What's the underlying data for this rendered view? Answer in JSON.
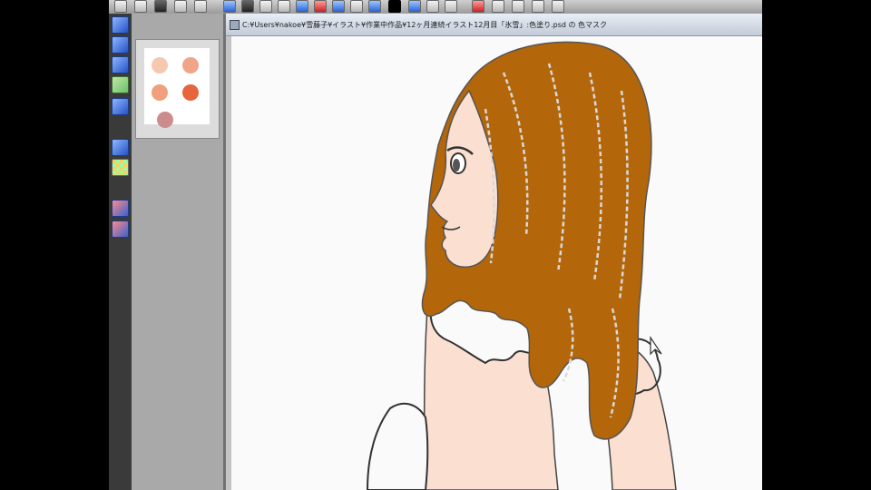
{
  "window": {
    "title": "C:¥Users¥nakoe¥雪藤子¥イラスト¥作業中作品¥12ヶ月連続イラスト12月目「氷雪」:色塗り.psd の 色マスク"
  },
  "palette": {
    "swatches": [
      "#f7c8b0",
      "#f0a488",
      "#f0a07c",
      "#e8643c",
      "#cc8c8c"
    ]
  },
  "canvas": {
    "hair_color": "#b4660a",
    "skin_color": "#fbe0d2"
  },
  "colors": {
    "toolbar_blue": "#2a62d8",
    "panel_gray": "#a9a9a9",
    "app_background": "#3c3c3c"
  }
}
